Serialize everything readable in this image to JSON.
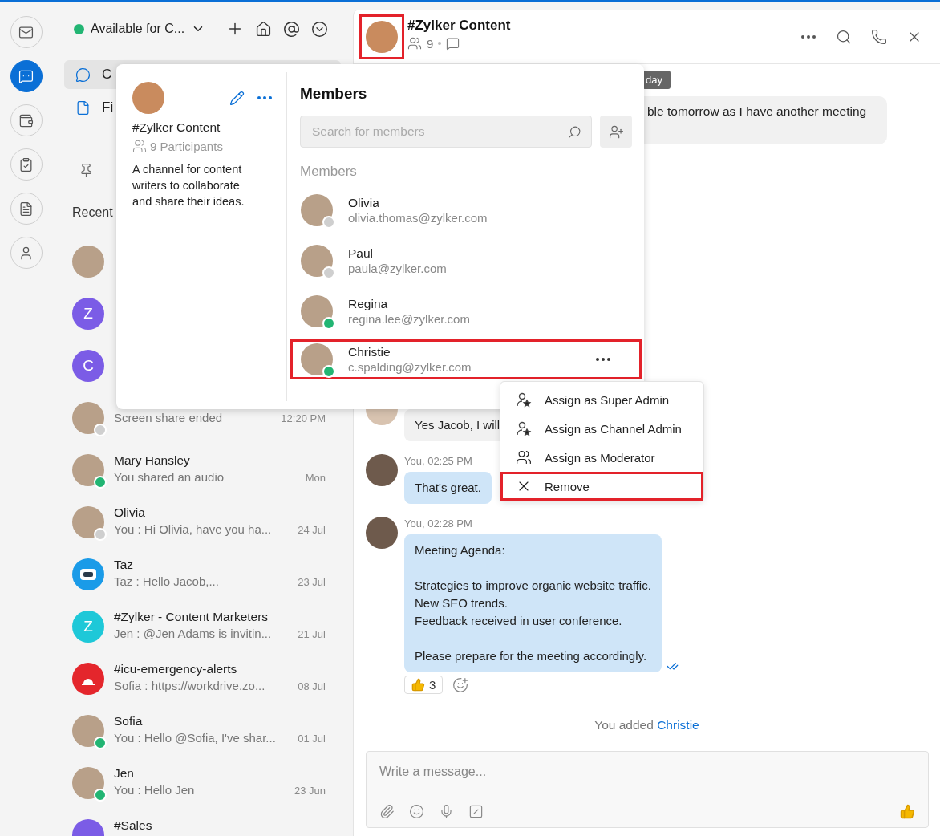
{
  "rail": [
    {
      "selected": false
    },
    {
      "selected": true
    },
    {
      "selected": false
    },
    {
      "selected": false
    },
    {
      "selected": false
    },
    {
      "selected": false
    }
  ],
  "status": {
    "label": "Available for C...",
    "online": true
  },
  "nav": [
    {
      "label": "C",
      "selected": true
    },
    {
      "label": "Fi",
      "selected": false
    }
  ],
  "recent_title": "Recent",
  "recent": [
    {
      "avatar": {
        "kind": "photo"
      }
    },
    {
      "avatar": {
        "kind": "letter",
        "letter": "Z",
        "color": "#7b5ce6"
      }
    },
    {
      "avatar": {
        "kind": "letter",
        "letter": "C",
        "color": "#7b5ce6"
      }
    },
    {
      "avatar": {
        "kind": "photo",
        "online": false
      },
      "preview": "Screen share ended",
      "time": "12:20 PM"
    },
    {
      "avatar": {
        "kind": "photo",
        "online": true
      },
      "name": "Mary Hansley",
      "preview": "You shared an audio",
      "time": "Mon"
    },
    {
      "avatar": {
        "kind": "photo",
        "online": false
      },
      "name": "Olivia",
      "preview": "You : Hi Olivia, have you ha...",
      "time": "24 Jul"
    },
    {
      "avatar": {
        "kind": "bot"
      },
      "name": "Taz",
      "preview": "Taz : Hello Jacob,...",
      "time": "23 Jul"
    },
    {
      "avatar": {
        "kind": "letter",
        "letter": "Z",
        "color": "#1ec8d8"
      },
      "name": "#Zylker - Content Marketers",
      "preview": "Jen : @Jen Adams  is invitin...",
      "time": "21 Jul"
    },
    {
      "avatar": {
        "kind": "alert"
      },
      "name": "#icu-emergency-alerts",
      "preview": "Sofia : https://workdrive.zo...",
      "time": "08 Jul"
    },
    {
      "avatar": {
        "kind": "photo",
        "online": true
      },
      "name": "Sofia",
      "preview": "You : Hello @Sofia, I've shar...",
      "time": "01 Jul"
    },
    {
      "avatar": {
        "kind": "photo",
        "online": true
      },
      "name": "Jen",
      "preview": "You : Hello Jen",
      "time": "23 Jun"
    },
    {
      "avatar": {
        "kind": "letter",
        "color": "#7b5ce6"
      },
      "name": "#Sales"
    }
  ],
  "chat": {
    "title": "#Zylker Content",
    "member_count": "9",
    "avatar_highlighted": true,
    "date_chip": "day",
    "messages": [
      {
        "kind": "clipped",
        "text": "ble tomorrow as I have another meeting"
      },
      {
        "kind": "received",
        "text": "Yes Jacob, I will"
      },
      {
        "kind": "sent",
        "meta": "You, 02:25 PM",
        "text": "That's great.",
        "read": false
      },
      {
        "kind": "sent",
        "meta": "You, 02:28 PM",
        "text": "Meeting Agenda:\n\nStrategies to improve organic website traffic.\nNew SEO trends.\nFeedback received in user conference.\n\nPlease prepare for the meeting accordingly.",
        "read": true,
        "reaction_count": "3"
      }
    ],
    "system_note": {
      "text": "You added",
      "link": "Christie"
    },
    "composer": {
      "placeholder": "Write a message..."
    }
  },
  "popover": {
    "name": "#Zylker Content",
    "participants": "9 Participants",
    "description": "A channel for content writers to collaborate and share their ideas.",
    "title": "Members",
    "search_placeholder": "Search for members",
    "section": "Members",
    "members": [
      {
        "name": "Olivia",
        "email": "olivia.thomas@zylker.com",
        "online": false,
        "highlighted": false
      },
      {
        "name": "Paul",
        "email": "paula@zylker.com",
        "online": false,
        "highlighted": false
      },
      {
        "name": "Regina",
        "email": "regina.lee@zylker.com",
        "online": true,
        "highlighted": false
      },
      {
        "name": "Christie",
        "email": "c.spalding@zylker.com",
        "online": true,
        "highlighted": true
      }
    ]
  },
  "menu": {
    "items": [
      {
        "label": "Assign as Super Admin",
        "kind": "super-admin",
        "highlighted": false
      },
      {
        "label": "Assign as Channel Admin",
        "kind": "channel-admin",
        "highlighted": false
      },
      {
        "label": "Assign as Moderator",
        "kind": "moderator",
        "highlighted": false
      },
      {
        "label": "Remove",
        "kind": "remove",
        "highlighted": true
      }
    ]
  }
}
